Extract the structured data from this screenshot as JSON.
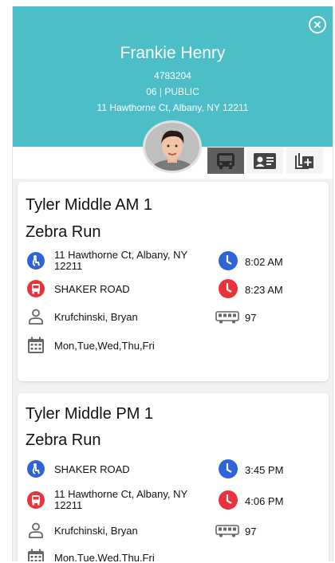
{
  "header": {
    "name": "Frankie Henry",
    "id_number": "4783204",
    "grade_school": "06 | PUBLIC",
    "address": "11 Hawthorne Ct, Albany, NY 12211"
  },
  "tabs": [
    {
      "icon": "bus-icon",
      "active": true
    },
    {
      "icon": "id-card-icon",
      "active": false
    },
    {
      "icon": "add-layers-icon",
      "active": false
    }
  ],
  "routes": [
    {
      "school_run": "Tyler Middle AM 1",
      "run_name": "Zebra Run",
      "pickup": "11 Hawthorne Ct, Albany, NY 12211",
      "pickup_time": "8:02 AM",
      "dropoff": "SHAKER ROAD",
      "dropoff_time": "8:23 AM",
      "driver": "Krufchinski, Bryan",
      "bus": "97",
      "days": "Mon,Tue,Wed,Thu,Fri"
    },
    {
      "school_run": "Tyler Middle PM 1",
      "run_name": "Zebra Run",
      "pickup": "SHAKER ROAD",
      "pickup_time": "3:45 PM",
      "dropoff": "11 Hawthorne Ct, Albany, NY 12211",
      "dropoff_time": "4:06 PM",
      "driver": "Krufchinski, Bryan",
      "bus": "97",
      "days": "Mon,Tue,Wed,Thu,Fri"
    }
  ],
  "colors": {
    "header": "#4cbec8",
    "pickup_blue": "#2f63d8",
    "dropoff_red": "#e8333c",
    "tab_active": "#5f5f5f"
  }
}
